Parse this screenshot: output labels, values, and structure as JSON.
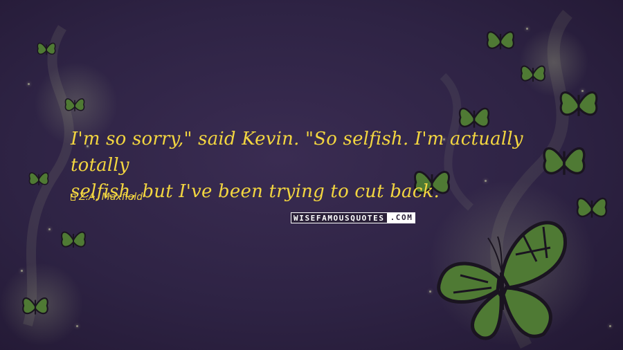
{
  "quote": {
    "line1": "I'm so sorry,\" said Kevin. \"So selfish. I'm actually totally",
    "line2": "selfish, but I've been trying to cut back."
  },
  "author": {
    "name": "Z.A. Maxfield",
    "icon": "author-square-icon"
  },
  "watermark": {
    "left": "WISEFAMOUSQUOTES",
    "right": ".COM"
  },
  "colors": {
    "background": "#2e2344",
    "text": "#f3d640",
    "butterfly_wing": "#4f7a34",
    "butterfly_edge": "#1a1420"
  }
}
